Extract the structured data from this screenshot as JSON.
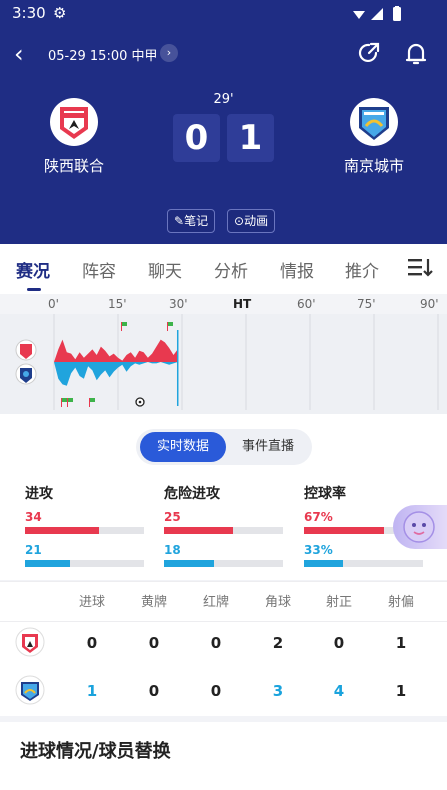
{
  "status_bar": {
    "time": "3:30"
  },
  "nav": {
    "match_info": "05-29 15:00 中甲",
    "chevron": "›"
  },
  "match": {
    "minute": "29'",
    "home": {
      "name": "陕西联合",
      "score": "0"
    },
    "away": {
      "name": "南京城市",
      "score": "1"
    }
  },
  "chips": {
    "notes": "笔记",
    "animation": "动画"
  },
  "tabs": [
    "赛况",
    "阵容",
    "聊天",
    "分析",
    "情报",
    "推介"
  ],
  "timeline": {
    "ticks": [
      "0'",
      "15'",
      "30'",
      "HT",
      "60'",
      "75'",
      "90'"
    ],
    "current_minute": 29,
    "home_pressure": [
      0.0,
      0.45,
      0.8,
      0.35,
      0.3,
      0.1,
      0.35,
      0.15,
      0.3,
      0.45,
      0.25,
      0.55,
      0.4,
      0.2,
      0.3,
      0.15,
      0.05,
      0.25,
      0.35,
      0.15,
      0.4,
      0.35,
      0.15,
      0.3,
      0.55,
      0.8,
      0.7,
      0.5,
      0.25,
      0.45
    ],
    "away_pressure": [
      0.0,
      0.6,
      0.8,
      0.85,
      0.4,
      0.2,
      0.5,
      0.6,
      0.15,
      0.3,
      0.65,
      0.45,
      0.3,
      0.55,
      0.35,
      0.2,
      0.1,
      0.35,
      0.15,
      0.05,
      0.1,
      0.05,
      0.0,
      0.05,
      0.05,
      0.0,
      0.05,
      0.1,
      0.05,
      0.0
    ],
    "colors": {
      "home": "#e8394f",
      "away": "#20a4dd",
      "grid": "#d8dae0"
    }
  },
  "stats": {
    "segment": {
      "on": "实时数据",
      "off": "事件直播"
    },
    "items": [
      {
        "title": "进攻",
        "home": "34",
        "away": "21",
        "home_frac": 0.62,
        "away_frac": 0.38
      },
      {
        "title": "危险进攻",
        "home": "25",
        "away": "18",
        "home_frac": 0.58,
        "away_frac": 0.42
      },
      {
        "title": "控球率",
        "home": "67%",
        "away": "33%",
        "home_frac": 0.67,
        "away_frac": 0.33
      }
    ]
  },
  "table": {
    "headers": [
      "进球",
      "黄牌",
      "红牌",
      "角球",
      "射正",
      "射偏"
    ],
    "home": [
      "0",
      "0",
      "0",
      "2",
      "0",
      "1"
    ],
    "away": [
      "1",
      "0",
      "0",
      "3",
      "4",
      "1"
    ]
  },
  "goals_section": {
    "title": "进球情况/球员替换"
  },
  "colors": {
    "header_bg": "#1f2d84",
    "home": "#e8394f",
    "away": "#20a4dd",
    "accent": "#2a5ad9"
  }
}
